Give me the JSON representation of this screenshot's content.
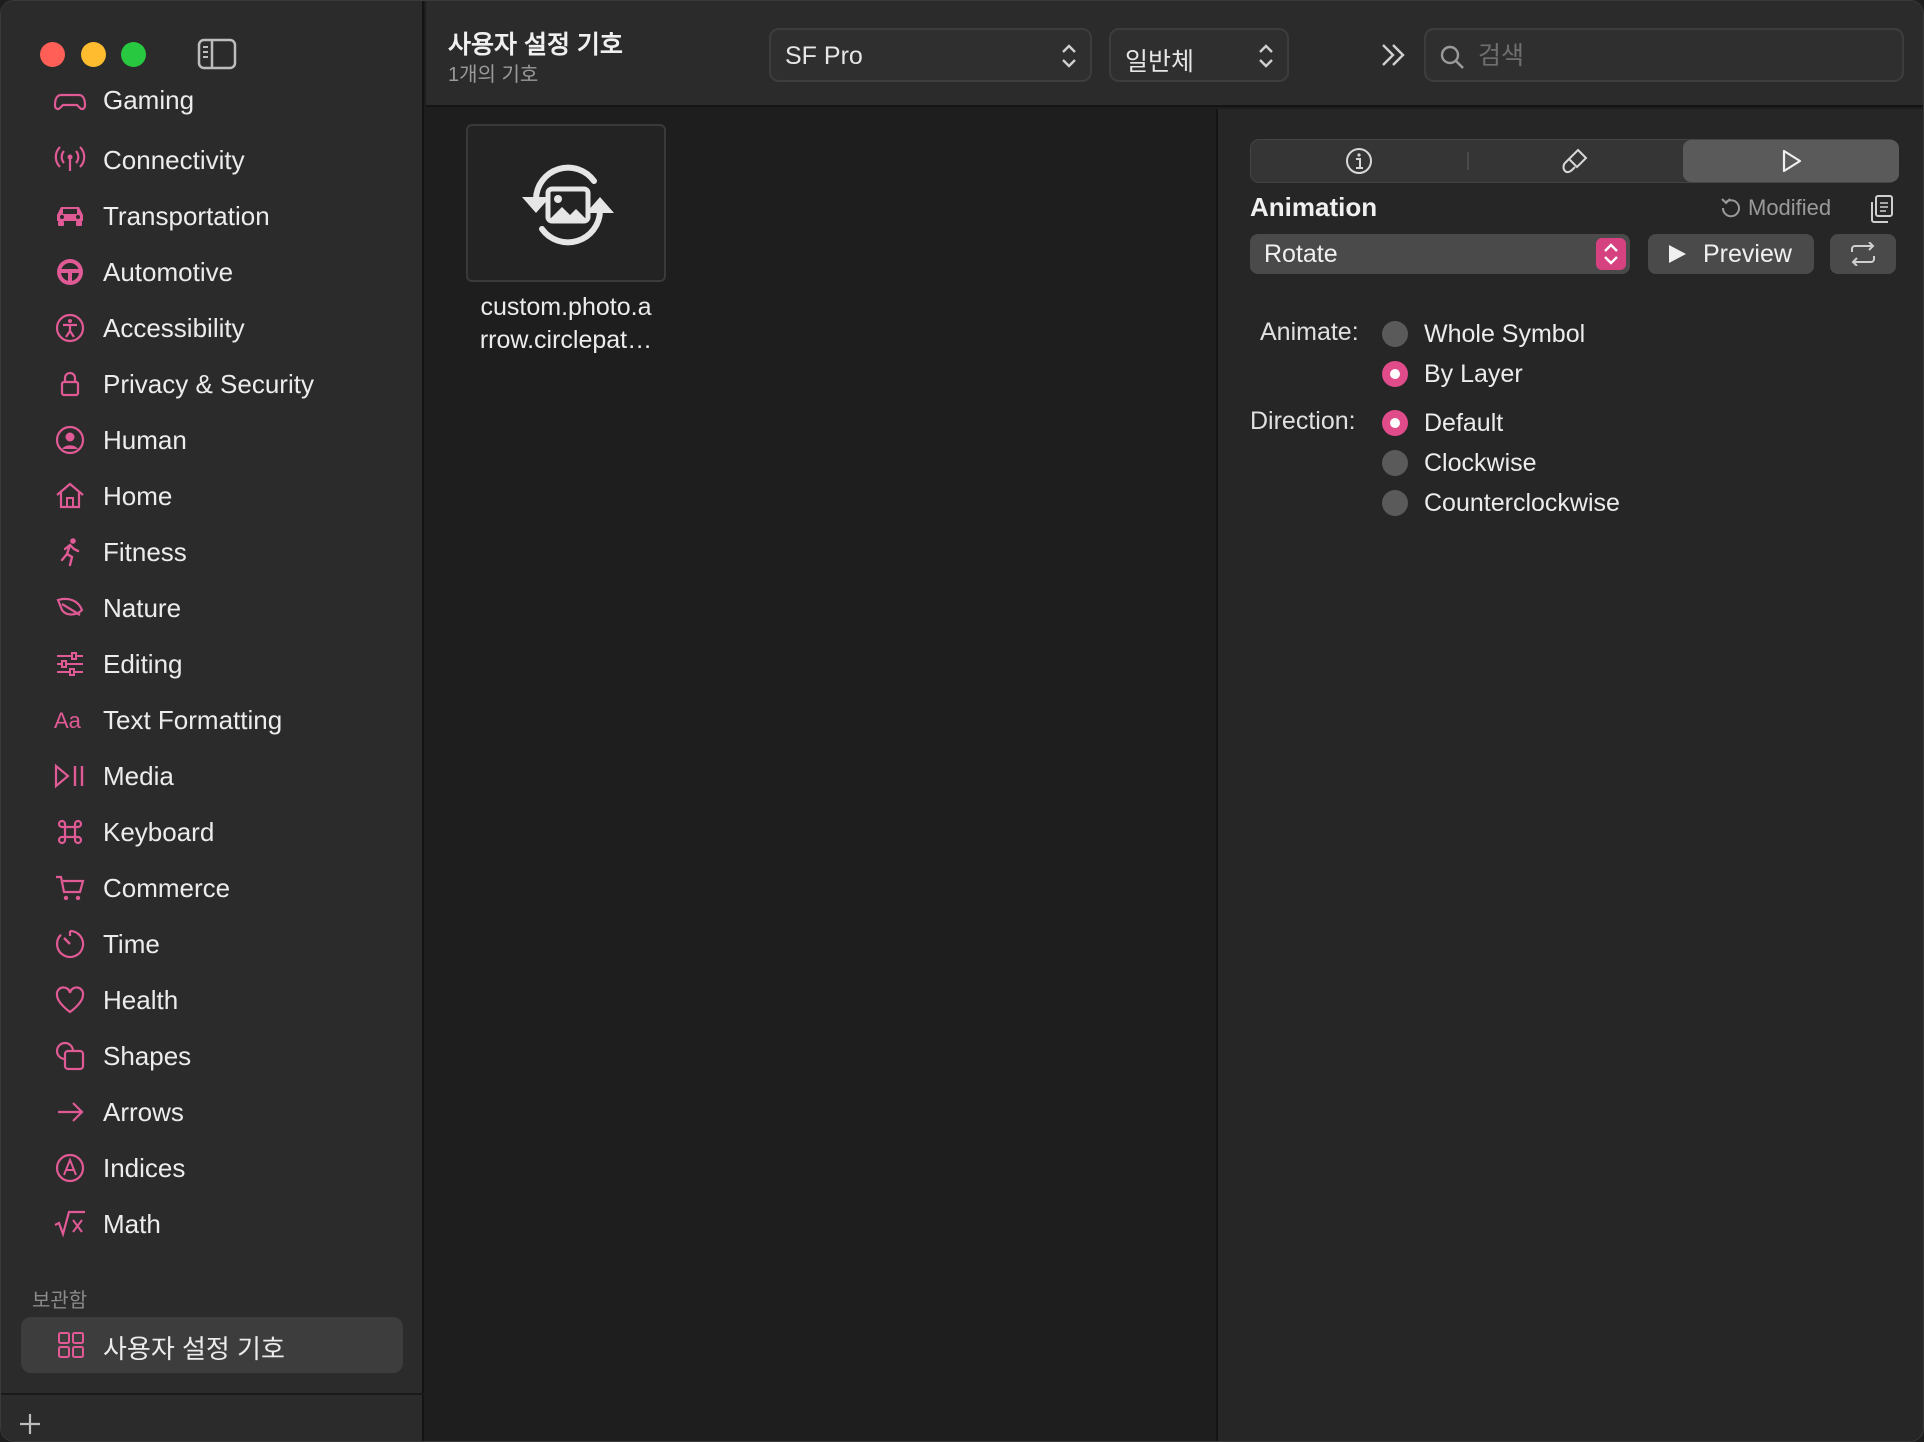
{
  "toolbar": {
    "title": "사용자 설정 기호",
    "subtitle": "1개의 기호",
    "font_value": "SF Pro",
    "weight_value": "일반체",
    "search_placeholder": "검색"
  },
  "sidebar": {
    "items": [
      {
        "label": "Gaming",
        "icon": "gamecontroller-icon"
      },
      {
        "label": "Connectivity",
        "icon": "antenna-icon"
      },
      {
        "label": "Transportation",
        "icon": "car-icon"
      },
      {
        "label": "Automotive",
        "icon": "steeringwheel-icon"
      },
      {
        "label": "Accessibility",
        "icon": "accessibility-icon"
      },
      {
        "label": "Privacy & Security",
        "icon": "lock-icon"
      },
      {
        "label": "Human",
        "icon": "person-circle-icon"
      },
      {
        "label": "Home",
        "icon": "house-icon"
      },
      {
        "label": "Fitness",
        "icon": "figure-run-icon"
      },
      {
        "label": "Nature",
        "icon": "leaf-icon"
      },
      {
        "label": "Editing",
        "icon": "sliders-icon"
      },
      {
        "label": "Text Formatting",
        "icon": "textformat-icon"
      },
      {
        "label": "Media",
        "icon": "playpause-icon"
      },
      {
        "label": "Keyboard",
        "icon": "command-icon"
      },
      {
        "label": "Commerce",
        "icon": "cart-icon"
      },
      {
        "label": "Time",
        "icon": "timer-icon"
      },
      {
        "label": "Health",
        "icon": "heart-icon"
      },
      {
        "label": "Shapes",
        "icon": "shapes-icon"
      },
      {
        "label": "Arrows",
        "icon": "arrow-right-icon"
      },
      {
        "label": "Indices",
        "icon": "a-circle-icon"
      },
      {
        "label": "Math",
        "icon": "squareroot-icon"
      }
    ],
    "section_label": "보관함",
    "custom_item_label": "사용자 설정 기호"
  },
  "content": {
    "glyph_name": "custom.photo.a rrow.circlepat…",
    "glyph_icon": "photo-arrow-circlepath-icon"
  },
  "inspector": {
    "heading": "Animation",
    "modified_label": "Modified",
    "animation_value": "Rotate",
    "preview_label": "Preview",
    "animate_label": "Animate:",
    "animate_options": [
      "Whole Symbol",
      "By Layer"
    ],
    "animate_selected": 1,
    "direction_label": "Direction:",
    "direction_options": [
      "Default",
      "Clockwise",
      "Counterclockwise"
    ],
    "direction_selected": 0
  },
  "colors": {
    "accent": "#e04b8a",
    "sidebar_icon": "#e05a95"
  }
}
